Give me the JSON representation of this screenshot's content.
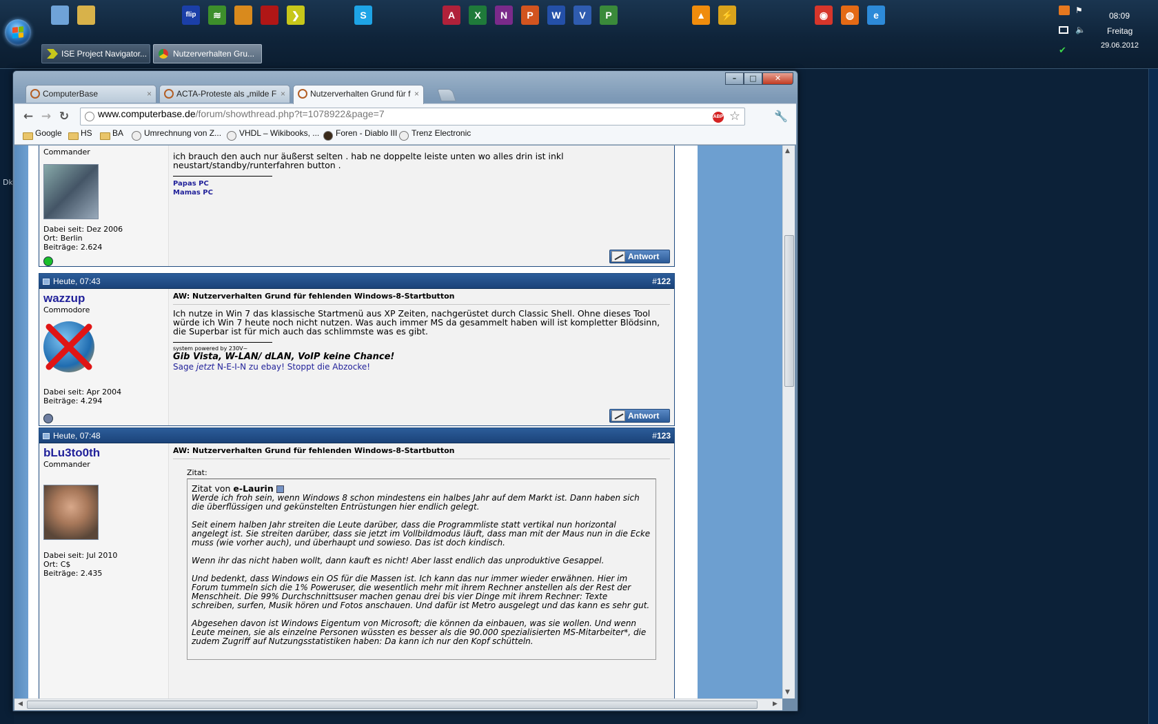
{
  "taskbar": {
    "quick_launch": [
      {
        "name": "show-desktop-icon",
        "color": "#6fa3d8",
        "glyph": ""
      },
      {
        "name": "explorer-icon",
        "color": "#d8b24a",
        "glyph": ""
      },
      {
        "name": "atmel-flip-icon",
        "color": "#1b3fa8",
        "glyph": "flip"
      },
      {
        "name": "ise-icon",
        "color": "#3d8f2b",
        "glyph": "≋"
      },
      {
        "name": "tool-icon-orange",
        "color": "#d98a1d",
        "glyph": ""
      },
      {
        "name": "tool-icon-red",
        "color": "#b01616",
        "glyph": ""
      },
      {
        "name": "ise-project-navigator-icon",
        "color": "#c7c71a",
        "glyph": "❯"
      },
      {
        "name": "skype-icon",
        "color": "#1ea4e6",
        "glyph": "S"
      },
      {
        "name": "access-icon",
        "color": "#b0213a",
        "glyph": "A"
      },
      {
        "name": "excel-icon",
        "color": "#1f7a3a",
        "glyph": "X"
      },
      {
        "name": "onenote-icon",
        "color": "#7a2a8a",
        "glyph": "N"
      },
      {
        "name": "powerpoint-icon",
        "color": "#d2541f",
        "glyph": "P"
      },
      {
        "name": "word-icon",
        "color": "#2450a8",
        "glyph": "W"
      },
      {
        "name": "visio-icon",
        "color": "#2f5cb0",
        "glyph": "V"
      },
      {
        "name": "project-icon",
        "color": "#3a8a3a",
        "glyph": "P"
      },
      {
        "name": "vlc-icon",
        "color": "#f08c0c",
        "glyph": "▲"
      },
      {
        "name": "tool-icon-bolt",
        "color": "#d9a21b",
        "glyph": "⚡"
      },
      {
        "name": "chrome-icon",
        "color": "#d6362b",
        "glyph": "◉"
      },
      {
        "name": "firefox-icon",
        "color": "#e46a15",
        "glyph": "◍"
      },
      {
        "name": "ie-icon",
        "color": "#2d8ad8",
        "glyph": "e"
      }
    ],
    "buttons": [
      {
        "label": "ISE Project Navigator...",
        "active": false
      },
      {
        "label": "Nutzerverhalten Gru...",
        "active": true
      }
    ],
    "clock": {
      "time": "08:09",
      "day": "Freitag",
      "date": "29.06.2012"
    }
  },
  "desktop": {
    "label": "Dk"
  },
  "window": {
    "controls": {
      "minimize": "–",
      "maximize": "□",
      "close": "✕"
    },
    "tabs": [
      {
        "label": "ComputerBase",
        "close": "×"
      },
      {
        "label": "ACTA-Proteste als „milde F",
        "close": "×"
      },
      {
        "label": "Nutzerverhalten Grund für f",
        "close": "×"
      }
    ],
    "url_host": "www.computerbase.de",
    "url_path": "/forum/showthread.php?t=1078922&page=7",
    "abp_label": "ABP",
    "bookmarks": [
      {
        "label": "Google",
        "type": "folder"
      },
      {
        "label": "HS",
        "type": "folder"
      },
      {
        "label": "BA",
        "type": "folder"
      },
      {
        "label": "Umrechnung von Z...",
        "type": "site"
      },
      {
        "label": "VHDL – Wikibooks, ...",
        "type": "site"
      },
      {
        "label": "Foren - Diablo III",
        "type": "site"
      },
      {
        "label": "Trenz Electronic",
        "type": "site"
      }
    ]
  },
  "posts": {
    "p121": {
      "rank": "Commander",
      "joined": "Dabei seit: Dez 2006",
      "location": "Ort: Berlin",
      "count": "Beiträge: 2.624",
      "text1": "ich brauch den auch nur äußerst selten . hab ne doppelte leiste unten wo alles drin ist inkl",
      "text2": "neustart/standby/runterfahren button .",
      "sig1": "Papas PC",
      "sig2": "Mamas PC",
      "reply": "Antwort",
      "online_color": "#1bbf2b"
    },
    "p122": {
      "time": "Heute, 07:43",
      "num_prefix": "#",
      "num": "122",
      "user": "wazzup",
      "rank": "Commodore",
      "joined": "Dabei seit: Apr 2004",
      "count": "Beiträge: 4.294",
      "title": "AW: Nutzerverhalten Grund für fehlenden Windows-8-Startbutton",
      "line1": "Ich nutze in Win 7 das klassische Startmenü aus XP Zeiten, nachgerüstet durch Classic Shell. Ohne dieses Tool",
      "line2": "würde ich Win 7 heute noch nicht nutzen. Was auch immer MS da gesammelt haben will ist kompletter Blödsinn,",
      "line3": "die Superbar ist für mich auch das schlimmste was es gibt.",
      "sig_small": "system powered by 230V~",
      "sig_bold": "Gib Vista, W-LAN/ dLAN, VoIP keine Chance!",
      "sig_blue_a": "Sage ",
      "sig_blue_em": "jetzt",
      "sig_blue_b": " N-E-I-N zu ebay! Stoppt die Abzocke!",
      "reply": "Antwort",
      "online_color": "#6f7ea0"
    },
    "p123": {
      "time": "Heute, 07:48",
      "num_prefix": "#",
      "num": "123",
      "user": "bLu3to0th",
      "rank": "Commander",
      "joined": "Dabei seit: Jul 2010",
      "location": "Ort: C$",
      "count": "Beiträge: 2.435",
      "title": "AW: Nutzerverhalten Grund für fehlenden Windows-8-Startbutton",
      "quote_label": "Zitat:",
      "quote_from": "Zitat von ",
      "quote_author": "e-Laurin",
      "q1": "Werde ich froh sein, wenn Windows 8 schon mindestens ein halbes Jahr auf dem Markt ist. Dann haben sich die überflüssigen und gekünstelten Entrüstungen hier endlich gelegt.",
      "q2": "Seit einem halben Jahr streiten die Leute darüber, dass die Programmliste statt vertikal nun horizontal angelegt ist. Sie streiten darüber, dass sie jetzt im Vollbildmodus läuft, dass man mit der Maus nun in die Ecke muss (wie vorher auch), und überhaupt und sowieso. Das ist doch kindisch.",
      "q3": "Wenn ihr das nicht haben wollt, dann kauft es nicht! Aber lasst endlich das unproduktive Gesappel.",
      "q4": "Und bedenkt, dass Windows ein OS für die Massen ist. Ich kann das nur immer wieder erwähnen. Hier im Forum tummeln sich die 1% Poweruser, die wesentlich mehr mit ihrem Rechner anstellen als der Rest der Menschheit. Die 99% Durchschnittsuser machen genau drei bis vier Dinge mit ihrem Rechner: Texte schreiben, surfen, Musik hören und Fotos anschauen. Und dafür ist Metro ausgelegt und das kann es sehr gut.",
      "q5": "Abgesehen davon ist Windows Eigentum von Microsoft; die können da einbauen, was sie wollen. Und wenn Leute meinen, sie als einzelne Personen wüssten es besser als die 90.000 spezialisierten MS-Mitarbeiter*, die zudem Zugriff auf Nutzungsstatistiken haben: Da kann ich nur den Kopf schütteln."
    }
  }
}
